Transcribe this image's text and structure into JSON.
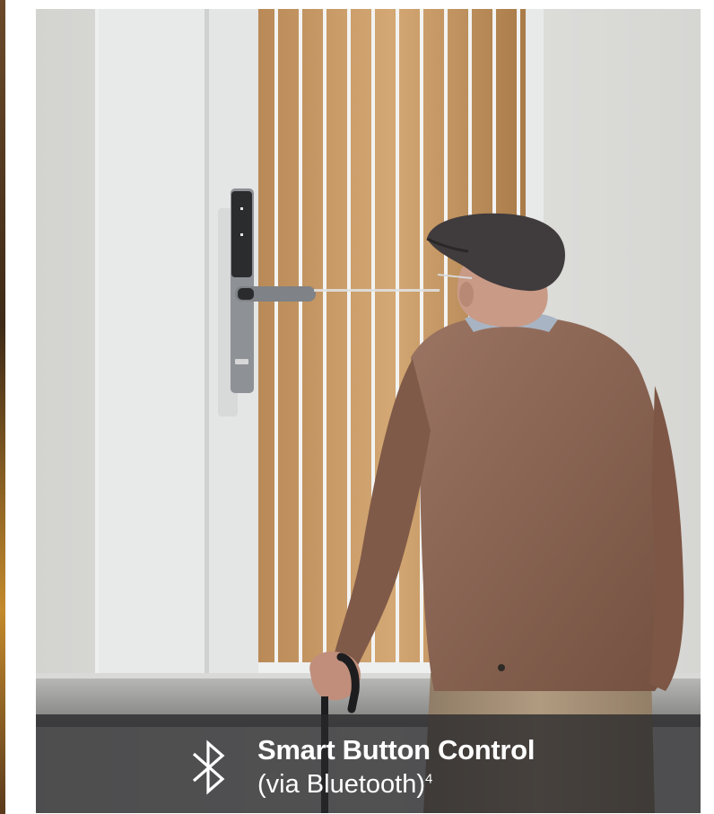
{
  "caption": {
    "title": "Smart Button Control",
    "subtitle": "(via Bluetooth)",
    "footnote": "4"
  },
  "icons": {
    "caption_icon": "bluetooth-icon"
  },
  "colors": {
    "caption_bar": "#28282a",
    "caption_text": "#ffffff",
    "wall": "#dcdcd9",
    "door": "#e9eaea",
    "wood_slats": "#c89a62",
    "sweater": "#8a6450",
    "cap": "#3f3b3c",
    "trousers": "#9f8a72",
    "lock": "#8f9296"
  }
}
